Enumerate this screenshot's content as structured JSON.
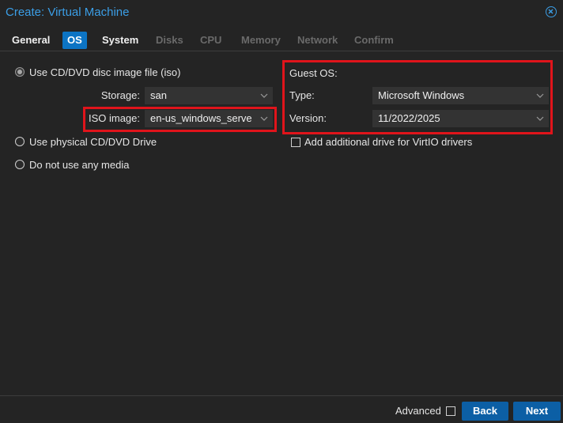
{
  "window": {
    "title": "Create: Virtual Machine"
  },
  "tabs": [
    {
      "label": "General",
      "state": "normal"
    },
    {
      "label": "OS",
      "state": "active"
    },
    {
      "label": "System",
      "state": "normal"
    },
    {
      "label": "Disks",
      "state": "disabled"
    },
    {
      "label": "CPU",
      "state": "disabled"
    },
    {
      "label": "Memory",
      "state": "disabled"
    },
    {
      "label": "Network",
      "state": "disabled"
    },
    {
      "label": "Confirm",
      "state": "disabled"
    }
  ],
  "media": {
    "use_iso_label": "Use CD/DVD disc image file (iso)",
    "storage_label": "Storage:",
    "storage_value": "san",
    "iso_label": "ISO image:",
    "iso_value": "en-us_windows_serve",
    "physical_label": "Use physical CD/DVD Drive",
    "none_label": "Do not use any media"
  },
  "guest_os": {
    "title": "Guest OS:",
    "type_label": "Type:",
    "type_value": "Microsoft Windows",
    "version_label": "Version:",
    "version_value": "11/2022/2025",
    "virtio_label": "Add additional drive for VirtIO drivers"
  },
  "footer": {
    "advanced_label": "Advanced",
    "back_label": "Back",
    "next_label": "Next"
  },
  "colors": {
    "accent": "#3b9ee6",
    "tab_active": "#0c74c4",
    "button": "#0c5fa5",
    "highlight": "#e0141b"
  }
}
